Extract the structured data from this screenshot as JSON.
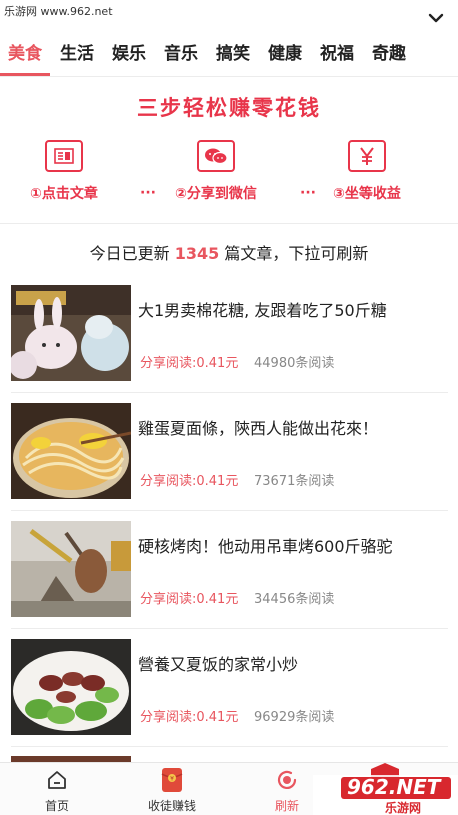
{
  "watermark": "乐游网 www.962.net",
  "tabs": [
    "美食",
    "生活",
    "娱乐",
    "音乐",
    "搞笑",
    "健康",
    "祝福",
    "奇趣"
  ],
  "promo": {
    "title": "三步轻松赚零花钱",
    "steps": [
      {
        "label": "①点击文章",
        "icon": "article-icon"
      },
      {
        "label": "②分享到微信",
        "icon": "wechat-icon"
      },
      {
        "label": "③坐等收益",
        "icon": "yen-icon"
      }
    ],
    "dots": "···"
  },
  "update": {
    "prefix": "今日已更新",
    "count": "1345",
    "suffix": "篇文章，下拉可刷新"
  },
  "articles": [
    {
      "title": "大1男卖棉花糖, 友跟着吃了50斤糖",
      "reward": "分享阅读:0.41元",
      "reads": "44980条阅读"
    },
    {
      "title": "雞蛋夏面條，陝西人能做出花來！",
      "reward": "分享阅读:0.41元",
      "reads": "73671条阅读"
    },
    {
      "title": "硬核烤肉！他动用吊車烤600斤骆驼",
      "reward": "分享阅读:0.41元",
      "reads": "34456条阅读"
    },
    {
      "title": "營養又夏饭的家常小炒",
      "reward": "分享阅读:0.41元",
      "reads": "96929条阅读"
    }
  ],
  "bottom_nav": [
    {
      "label": "首页",
      "icon": "home-icon"
    },
    {
      "label": "收徒赚钱",
      "icon": "red-envelope-icon"
    },
    {
      "label": "刷新",
      "icon": "refresh-icon"
    }
  ],
  "corner_logo": {
    "text": "962.NET",
    "sub": "乐游网"
  },
  "colors": {
    "accent": "#e8565f",
    "promo": "#e8354a",
    "muted": "#888888"
  }
}
